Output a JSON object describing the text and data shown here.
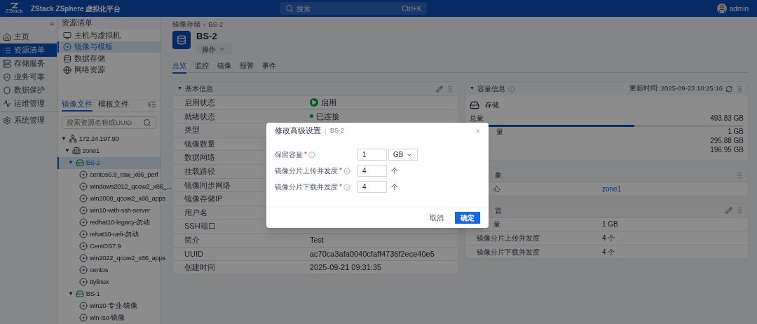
{
  "topbar": {
    "logo_text": "ZStack",
    "product": "ZStack ZSphere 虚拟化平台",
    "search": {
      "placeholder": "搜索",
      "shortcut": "Ctrl+K"
    },
    "user": "admin"
  },
  "nav": {
    "collapse": "«",
    "items": [
      {
        "label": "主页",
        "selected": false
      },
      {
        "label": "资源清单",
        "selected": true
      },
      {
        "label": "存储服务",
        "selected": false
      },
      {
        "label": "业务可靠",
        "selected": false
      },
      {
        "label": "数据保护",
        "selected": false
      },
      {
        "label": "运维管理",
        "selected": false
      },
      {
        "label": "系统管理",
        "selected": false
      }
    ]
  },
  "resource_menu": {
    "title": "资源清单",
    "items": [
      {
        "label": "主机与虚拟机",
        "selected": false
      },
      {
        "label": "镜像与模板",
        "selected": true
      },
      {
        "label": "数据存储",
        "selected": false
      },
      {
        "label": "网络资源",
        "selected": false
      }
    ],
    "tabs": [
      {
        "label": "镜像文件",
        "selected": true
      },
      {
        "label": "模板文件",
        "selected": false
      }
    ],
    "search": {
      "placeholder": "搜索资源名称或UUID"
    },
    "tree": [
      {
        "label": "172.24.197.90",
        "kind": "network",
        "toggle": "▼",
        "expanded": true,
        "selected": false,
        "children": [
          {
            "label": "zone1",
            "kind": "zone",
            "toggle": "▼",
            "expanded": true,
            "selected": false,
            "children": [
              {
                "label": "BS-2",
                "kind": "storage",
                "toggle": "▼",
                "expanded": true,
                "selected": true,
                "children": [
                  {
                    "label": "centos6.8_raw_x86_perf",
                    "kind": "image",
                    "selected": false
                  },
                  {
                    "label": "windows2012_qcow2_x86_...",
                    "kind": "image",
                    "selected": false
                  },
                  {
                    "label": "win2008_qcow2_x86_apps",
                    "kind": "image",
                    "selected": false
                  },
                  {
                    "label": "win10-with-ssh-server",
                    "kind": "image",
                    "selected": false
                  },
                  {
                    "label": "redhat10-legacy-勿动",
                    "kind": "image",
                    "selected": false
                  },
                  {
                    "label": "rehat10-uefi-勿动",
                    "kind": "image",
                    "selected": false
                  },
                  {
                    "label": "CentOS7.9",
                    "kind": "image",
                    "selected": false
                  },
                  {
                    "label": "win2022_qcow2_x86_apps",
                    "kind": "image",
                    "selected": false
                  },
                  {
                    "label": "centos",
                    "kind": "image",
                    "selected": false
                  },
                  {
                    "label": "ttylinux",
                    "kind": "image",
                    "selected": false
                  }
                ]
              },
              {
                "label": "BS-1",
                "kind": "storage",
                "toggle": "▼",
                "expanded": true,
                "selected": false,
                "children": [
                  {
                    "label": "win10-专业-镜像",
                    "kind": "image",
                    "selected": false
                  },
                  {
                    "label": "win-iso-镜像",
                    "kind": "image",
                    "selected": false
                  }
                ]
              }
            ]
          }
        ]
      }
    ]
  },
  "main": {
    "breadcrumb": [
      {
        "label": "镜像存储",
        "separator": "›"
      },
      {
        "label": "BS-2"
      }
    ],
    "title": "BS-2",
    "action": "操作",
    "tabs": [
      {
        "label": "总览",
        "selected": true
      },
      {
        "label": "监控",
        "selected": false
      },
      {
        "label": "镜像",
        "selected": false
      },
      {
        "label": "报警",
        "selected": false
      },
      {
        "label": "事件",
        "selected": false
      }
    ],
    "basic_info": {
      "title": "基本信息",
      "toggle": "▼",
      "rows": [
        {
          "label": "启用状态",
          "value": "启用",
          "kind": "enabled"
        },
        {
          "label": "就绪状态",
          "value": "已连接",
          "kind": "connected"
        },
        {
          "label": "类型"
        },
        {
          "label": "镜像数量"
        },
        {
          "label": "数据网络"
        },
        {
          "label": "挂载路径"
        },
        {
          "label": "镜像同步网络"
        },
        {
          "label": "镜像存储IP"
        },
        {
          "label": "用户名"
        },
        {
          "label": "SSH端口"
        },
        {
          "label": "简介",
          "value": "Test"
        },
        {
          "label": "UUID",
          "value": "ac70ca3afa0040cfaff4736f2ece40e5"
        },
        {
          "label": "创建时间",
          "value": "2025-09-21 09:31:35"
        }
      ]
    },
    "capacity": {
      "title": "容量信息",
      "toggle": "▼",
      "updated": "更新时间: 2025-09-23 10:25:16",
      "storage_label": "存储",
      "total_label": "总量",
      "total": "493.83 GB",
      "level": 0.6,
      "rows": [
        {
          "label": "量",
          "value": "1 GB"
        },
        {
          "value": "295.88 GB"
        },
        {
          "value": "196.95 GB"
        }
      ]
    },
    "related": {
      "title": "象",
      "rows": [
        {
          "label": "心",
          "value": "zone1",
          "kind": "link"
        }
      ]
    },
    "advanced": {
      "title": "置",
      "rows": [
        {
          "label": "量",
          "value": "1 GB"
        },
        {
          "label": "镜像分片上传并发度",
          "value": "4 个"
        },
        {
          "label": "镜像分片下载并发度",
          "value": "4 个"
        }
      ]
    }
  },
  "dialog": {
    "title": "修改高级设置",
    "subtitle": "BS-2",
    "close": "×",
    "fields": [
      {
        "label": "保留容量",
        "required_mark": "*",
        "value": "1",
        "kind": "unit_select",
        "unit": "GB"
      },
      {
        "label": "镜像分片上传并发度",
        "required_mark": "*",
        "value": "4",
        "kind": "suffix",
        "unit": "个"
      },
      {
        "label": "镜像分片下载并发度",
        "required_mark": "*",
        "value": "4",
        "kind": "suffix",
        "unit": "个"
      }
    ],
    "cancel": "取消",
    "confirm": "确定"
  }
}
